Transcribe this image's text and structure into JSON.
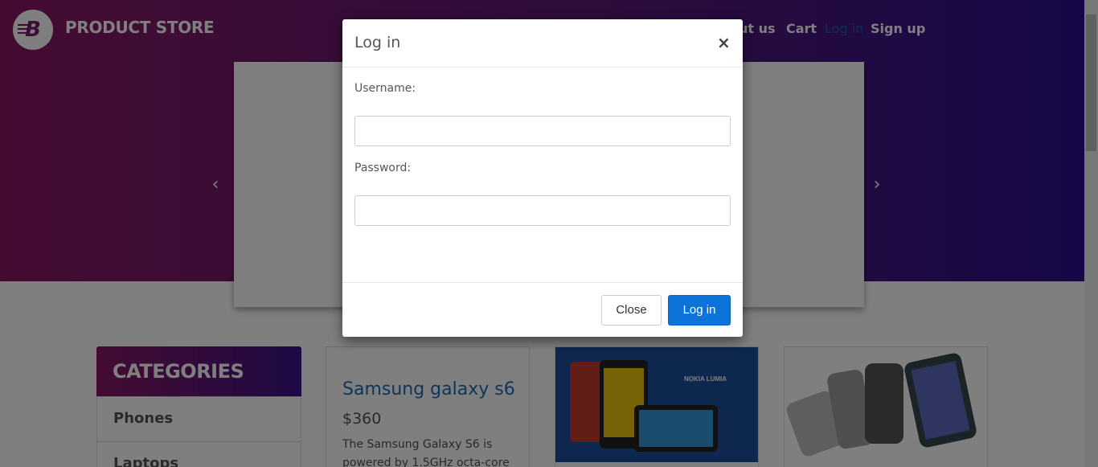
{
  "brand": {
    "name": "PRODUCT STORE",
    "logo_letter": "B"
  },
  "nav": {
    "about": "About us",
    "about_visible": "out us",
    "cart": "Cart",
    "login": "Log in",
    "signup": "Sign up"
  },
  "carousel": {
    "prev_icon": "‹",
    "next_icon": "›"
  },
  "categories": {
    "title": "CATEGORIES",
    "items": [
      "Phones",
      "Laptops"
    ]
  },
  "products": [
    {
      "title": "Samsung galaxy s6",
      "price": "$360",
      "description": "The Samsung Galaxy S6 is powered by 1.5GHz octa-core"
    }
  ],
  "product_images": {
    "nokia_label": "NOKIA LUMIA"
  },
  "modal": {
    "title": "Log in",
    "close_icon": "×",
    "username_label": "Username:",
    "password_label": "Password:",
    "username_value": "",
    "password_value": "",
    "close_button": "Close",
    "login_button": "Log in"
  },
  "colors": {
    "hero_start": "#8a1763",
    "hero_end": "#2d0f8c",
    "primary_button": "#0b73d9",
    "link": "#1f6bb5"
  }
}
